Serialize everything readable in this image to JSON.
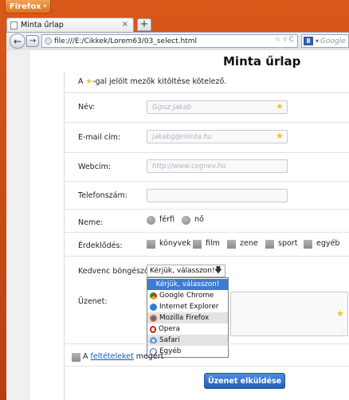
{
  "browser": {
    "menu_button": "Firefox",
    "tab_title": "Minta űrlap",
    "tab_close": "×",
    "new_tab": "+",
    "back": "←",
    "forward": "→",
    "url": "file:///E:/Cikkek/Lorem63/03_select.html",
    "url_icons": "☆ ▿ C",
    "search_engine": "8",
    "search_placeholder": "Google"
  },
  "form": {
    "title": "Minta űrlap",
    "required_note_prefix": "A ",
    "required_note_suffix": "-gal jelölt mezők kitöltése kötelező.",
    "name_label": "Név:",
    "name_placeholder": "Gipsz Jakab",
    "email_label": "E-mail cím:",
    "email_placeholder": "jakabg@minta.hu",
    "web_label": "Webcím:",
    "web_placeholder": "http://www.cegnev.hu",
    "phone_label": "Telefonszám:",
    "phone_value": "",
    "gender_label": "Neme:",
    "gender_options": [
      "férfi",
      "nő"
    ],
    "interests_label": "Érdeklődés:",
    "interests": [
      "könyvek",
      "film",
      "zene",
      "sport",
      "egyéb"
    ],
    "browser_label": "Kedvenc böngészője:",
    "browser_selected": "Kérjük, válasszon!",
    "browser_options": [
      "Kérjük, válasszon!",
      "Google Chrome",
      "Internet Explorer",
      "Mozilla Firefox",
      "Opera",
      "Safari",
      "Egyéb"
    ],
    "message_label": "Üzenet:",
    "terms_prefix": "A ",
    "terms_link": "feltételeket",
    "terms_suffix": " megért",
    "submit": "Üzenet elküldése"
  },
  "colors": {
    "accent": "#2e6fd0",
    "star": "#f1c232",
    "frame": "#c84b13"
  }
}
